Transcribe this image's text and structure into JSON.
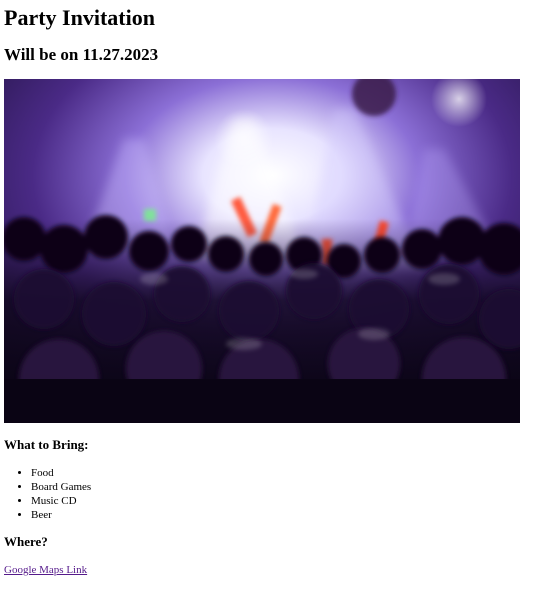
{
  "header": {
    "title": "Party Invitation",
    "subtitle": "Will be on 11.27.2023"
  },
  "hero_image": {
    "subject": "concert crowd in front of stage lights"
  },
  "bring": {
    "heading": "What to Bring:",
    "items": [
      "Food",
      "Board Games",
      "Music CD",
      "Beer"
    ]
  },
  "where": {
    "heading": "Where?",
    "link_label": "Google Maps Link"
  },
  "colors": {
    "text": "#000000",
    "visited_link": "#551a8b",
    "background": "#ffffff"
  }
}
